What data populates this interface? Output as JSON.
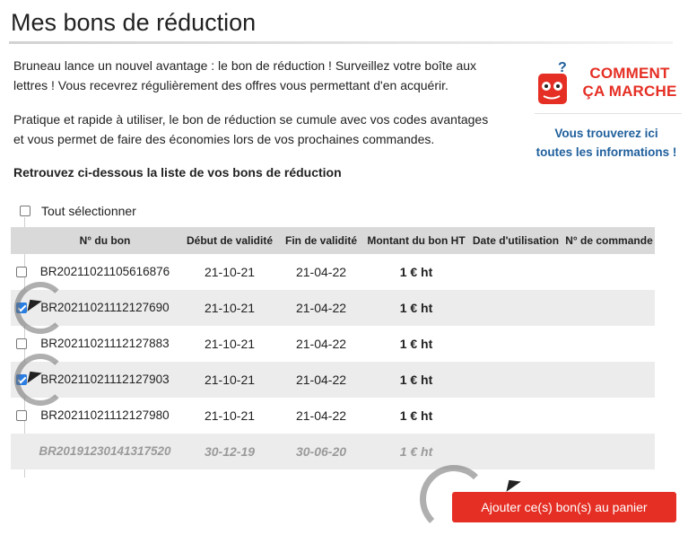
{
  "page": {
    "title": "Mes bons de réduction"
  },
  "intro": {
    "paragraph1": "Bruneau lance un nouvel avantage : le bon de réduction ! Surveillez votre boîte aux lettres ! Vous recevrez régulièrement des offres vous permettant d'en acquérir.",
    "paragraph2": "Pratique et rapide à utiliser, le bon de réduction se cumule avec vos codes avantages et vous permet de faire des économies lors de vos prochaines commandes.",
    "list_heading": "Retrouvez ci-dessous la liste de vos bons de réduction"
  },
  "help": {
    "title_line1": "COMMENT",
    "title_line2": "ÇA MARCHE",
    "text_line1": "Vous trouverez ici",
    "text_line2": "toutes les informations !",
    "icon": "help-mascot-icon"
  },
  "select_all": {
    "label": "Tout sélectionner",
    "checked": false
  },
  "table": {
    "headers": {
      "number": "N° du bon",
      "start": "Début de validité",
      "end": "Fin de validité",
      "amount": "Montant du bon HT",
      "use_date": "Date d'utilisation",
      "order": "N° de commande"
    },
    "rows": [
      {
        "number": "BR20211021105616876",
        "start": "21-10-21",
        "end": "21-04-22",
        "amount": "1 € ht",
        "use_date": "",
        "order": "",
        "checked": false
      },
      {
        "number": "BR20211021112127690",
        "start": "21-10-21",
        "end": "21-04-22",
        "amount": "1 € ht",
        "use_date": "",
        "order": "",
        "checked": true
      },
      {
        "number": "BR20211021112127883",
        "start": "21-10-21",
        "end": "21-04-22",
        "amount": "1 € ht",
        "use_date": "",
        "order": "",
        "checked": false
      },
      {
        "number": "BR20211021112127903",
        "start": "21-10-21",
        "end": "21-04-22",
        "amount": "1 € ht",
        "use_date": "",
        "order": "",
        "checked": true
      },
      {
        "number": "BR20211021112127980",
        "start": "21-10-21",
        "end": "21-04-22",
        "amount": "1 € ht",
        "use_date": "",
        "order": "",
        "checked": false
      },
      {
        "number": "BR20191230141317520",
        "start": "30-12-19",
        "end": "30-06-20",
        "amount": "1 € ht",
        "use_date": "",
        "order": "",
        "expired": true
      }
    ]
  },
  "cta": {
    "label": "Ajouter ce(s) bon(s) au panier"
  },
  "colors": {
    "accent_red": "#e52f24",
    "link_blue": "#1f5f9c",
    "check_blue": "#2a7de1"
  }
}
